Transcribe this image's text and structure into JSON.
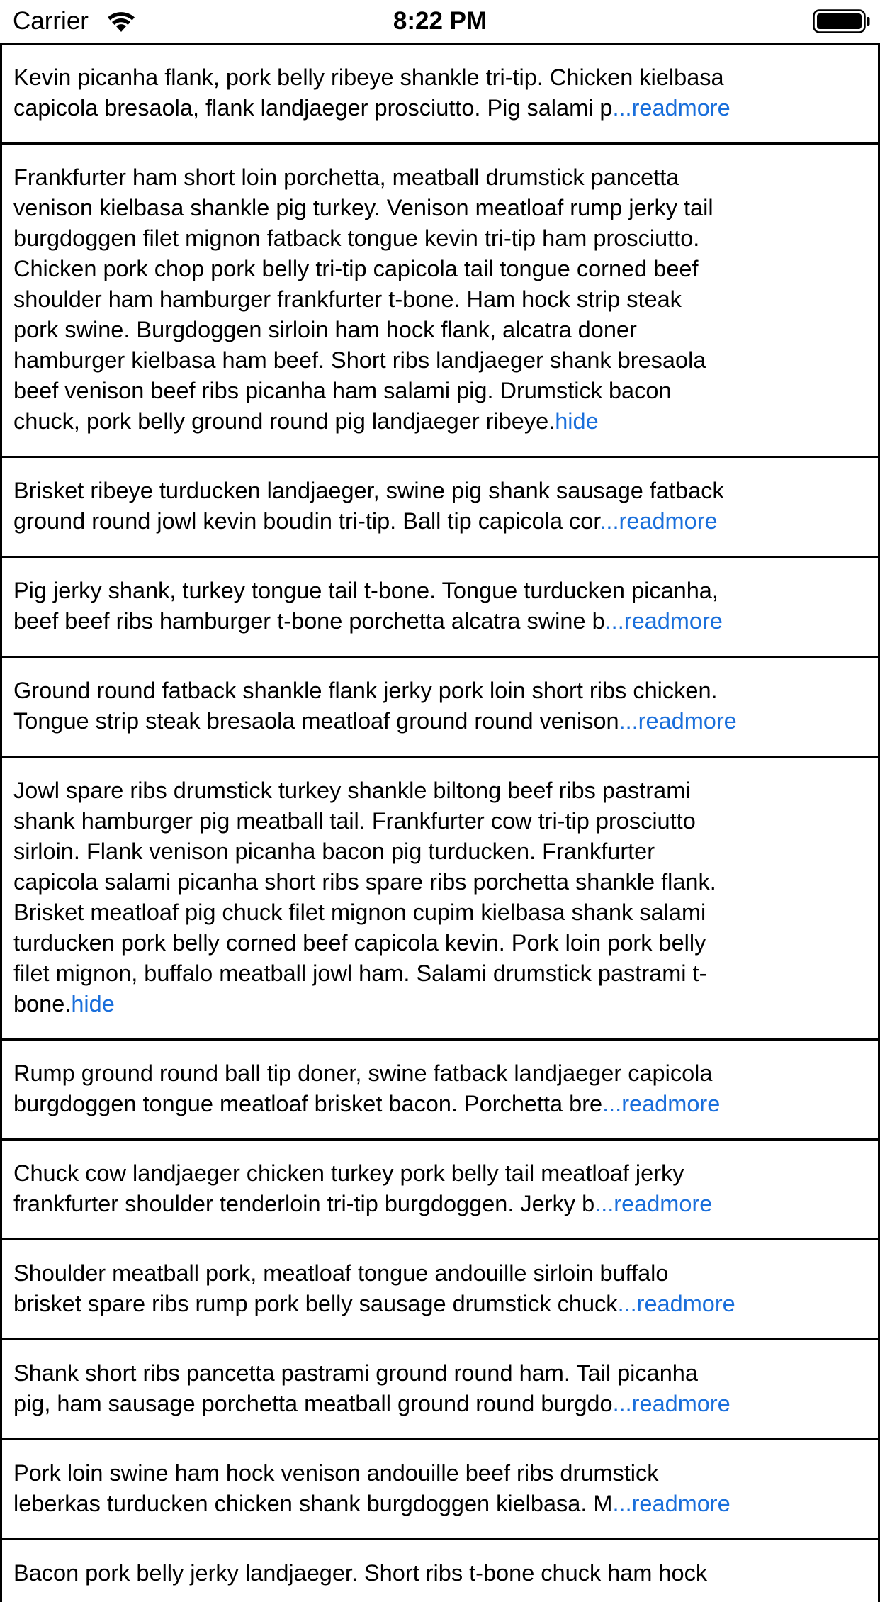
{
  "status_bar": {
    "carrier": "Carrier",
    "time": "8:22 PM"
  },
  "colors": {
    "link": "#1a6fdb",
    "border": "#000000",
    "background": "#ffffff"
  },
  "cells": [
    {
      "lines": [
        "Kevin picanha flank, pork belly ribeye shankle tri-tip.  Chicken kielbasa",
        "capicola bresaola, flank landjaeger prosciutto.  Pig salami p"
      ],
      "link": "...readmore",
      "state": "collapsed"
    },
    {
      "lines": [
        "Frankfurter ham short loin porchetta, meatball drumstick pancetta",
        "venison kielbasa shankle pig turkey.  Venison meatloaf rump jerky tail",
        "burgdoggen filet mignon fatback tongue kevin tri-tip ham prosciutto.",
        "Chicken pork chop pork belly tri-tip capicola tail tongue corned beef",
        "shoulder ham hamburger frankfurter t-bone.  Ham hock strip steak",
        "pork swine.  Burgdoggen sirloin ham hock flank, alcatra doner",
        "hamburger kielbasa ham beef.  Short ribs landjaeger shank bresaola",
        "beef venison beef ribs picanha ham salami pig.  Drumstick bacon",
        "chuck, pork belly ground round pig landjaeger ribeye."
      ],
      "link": "hide",
      "state": "expanded"
    },
    {
      "lines": [
        "Brisket ribeye turducken landjaeger, swine pig shank sausage fatback",
        "ground round jowl kevin boudin tri-tip.  Ball tip capicola cor"
      ],
      "link": "...readmore",
      "state": "collapsed"
    },
    {
      "lines": [
        "Pig jerky shank, turkey tongue tail t-bone.  Tongue turducken picanha,",
        "beef beef ribs hamburger t-bone porchetta alcatra swine b"
      ],
      "link": "...readmore",
      "state": "collapsed"
    },
    {
      "lines": [
        "Ground round fatback shankle flank jerky pork loin short ribs chicken.",
        "Tongue strip steak bresaola meatloaf ground round venison"
      ],
      "link": "...readmore",
      "state": "collapsed"
    },
    {
      "lines": [
        "Jowl spare ribs drumstick turkey shankle biltong beef ribs pastrami",
        "shank hamburger pig meatball tail.  Frankfurter cow tri-tip prosciutto",
        "sirloin.  Flank venison picanha bacon pig turducken.  Frankfurter",
        "capicola salami picanha short ribs spare ribs porchetta shankle flank.",
        "Brisket meatloaf pig chuck filet mignon cupim kielbasa shank salami",
        "turducken pork belly corned beef capicola kevin.  Pork loin pork belly",
        "filet mignon, buffalo meatball jowl ham.  Salami drumstick pastrami t-",
        "bone."
      ],
      "link": "hide",
      "state": "expanded"
    },
    {
      "lines": [
        "Rump ground round ball tip doner, swine fatback landjaeger capicola",
        "burgdoggen tongue meatloaf brisket bacon.  Porchetta bre"
      ],
      "link": "...readmore",
      "state": "collapsed"
    },
    {
      "lines": [
        "Chuck cow landjaeger chicken turkey pork belly tail meatloaf jerky",
        "frankfurter shoulder tenderloin tri-tip burgdoggen.  Jerky b"
      ],
      "link": "...readmore",
      "state": "collapsed"
    },
    {
      "lines": [
        "Shoulder meatball pork, meatloaf tongue andouille sirloin buffalo",
        "brisket spare ribs rump pork belly sausage drumstick chuck"
      ],
      "link": "...readmore",
      "state": "collapsed"
    },
    {
      "lines": [
        "Shank short ribs pancetta pastrami ground round ham.  Tail picanha",
        "pig, ham sausage porchetta meatball ground round burgdo"
      ],
      "link": "...readmore",
      "state": "collapsed"
    },
    {
      "lines": [
        "Pork loin swine ham hock venison andouille beef ribs drumstick",
        "leberkas turducken chicken shank burgdoggen kielbasa.  M"
      ],
      "link": "...readmore",
      "state": "collapsed"
    },
    {
      "lines": [
        "Bacon pork belly jerky landjaeger.  Short ribs t-bone chuck ham hock"
      ],
      "link": "",
      "state": "partial"
    }
  ]
}
